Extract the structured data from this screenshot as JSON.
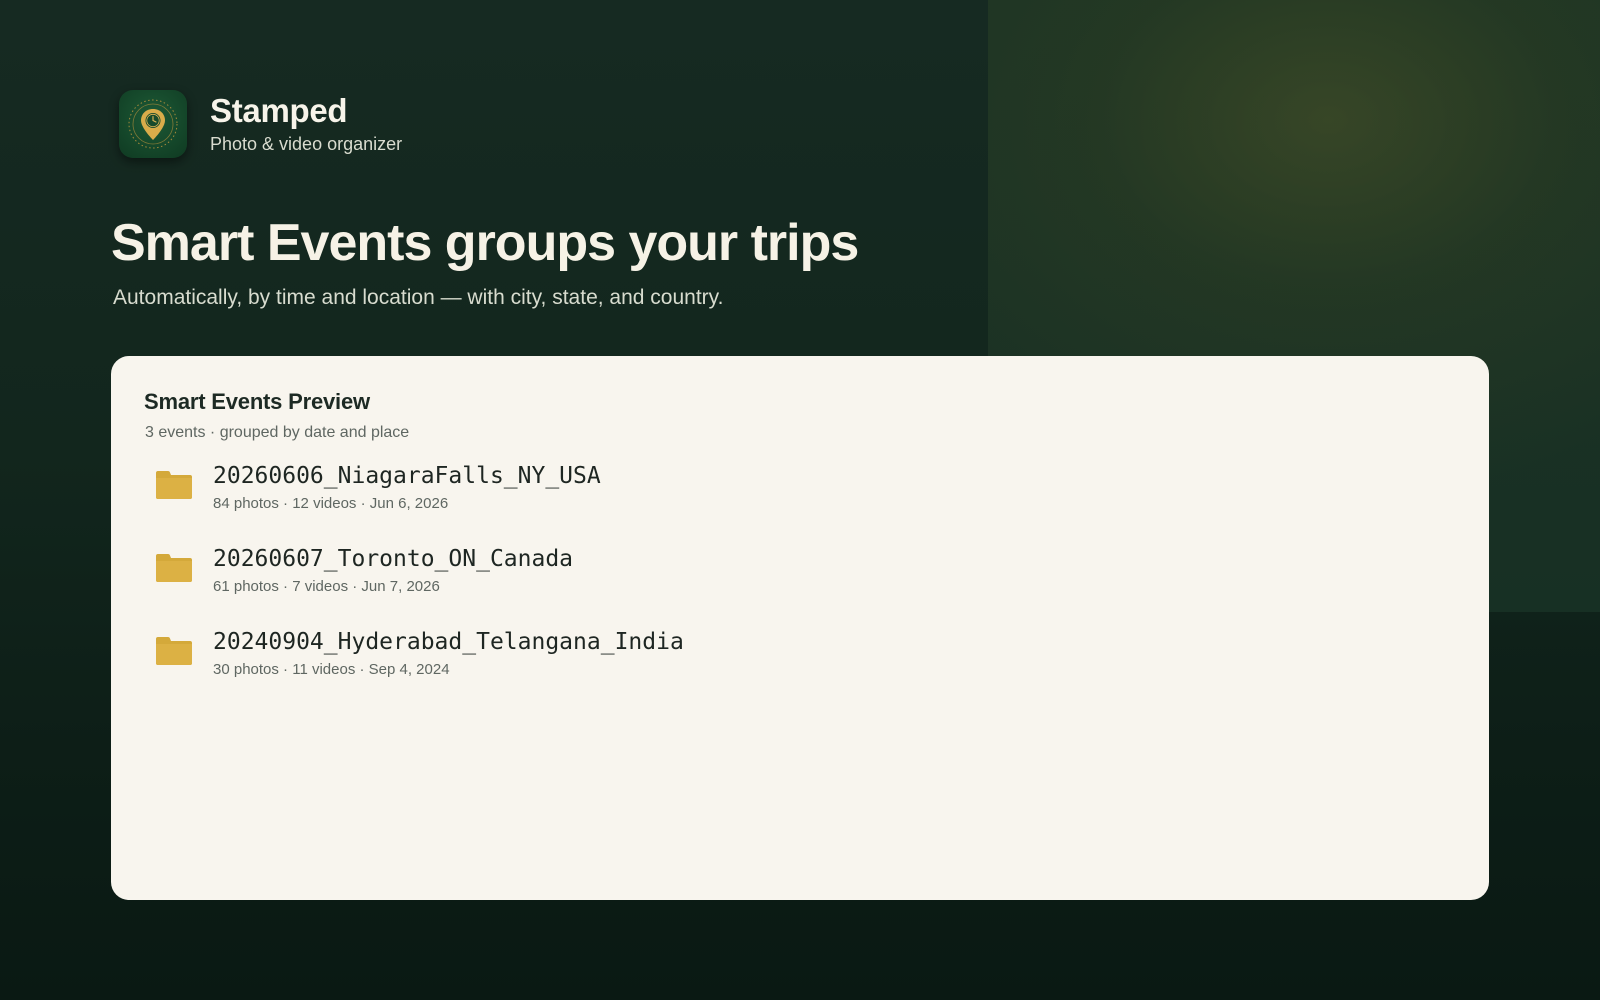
{
  "app": {
    "name": "Stamped",
    "subtitle": "Photo & video organizer",
    "icon": "map-pin-clock-icon"
  },
  "hero": {
    "headline": "Smart Events groups your trips",
    "tagline": "Automatically, by time and location — with city, state, and country."
  },
  "preview": {
    "title": "Smart Events Preview",
    "summary": "3 events · grouped by date and place",
    "events": [
      {
        "folder_name": "20260606_NiagaraFalls_NY_USA",
        "meta": "84 photos · 12 videos · Jun 6, 2026"
      },
      {
        "folder_name": "20260607_Toronto_ON_Canada",
        "meta": "61 photos · 7 videos · Jun 7, 2026"
      },
      {
        "folder_name": "20240904_Hyderabad_Telangana_India",
        "meta": "30 photos · 11 videos · Sep 4, 2024"
      }
    ]
  },
  "colors": {
    "background": "#12261d",
    "card": "#f8f5ee",
    "folder": "#d4a93a",
    "icon_green": "#1e5a36",
    "icon_gold": "#d9ac4a"
  }
}
